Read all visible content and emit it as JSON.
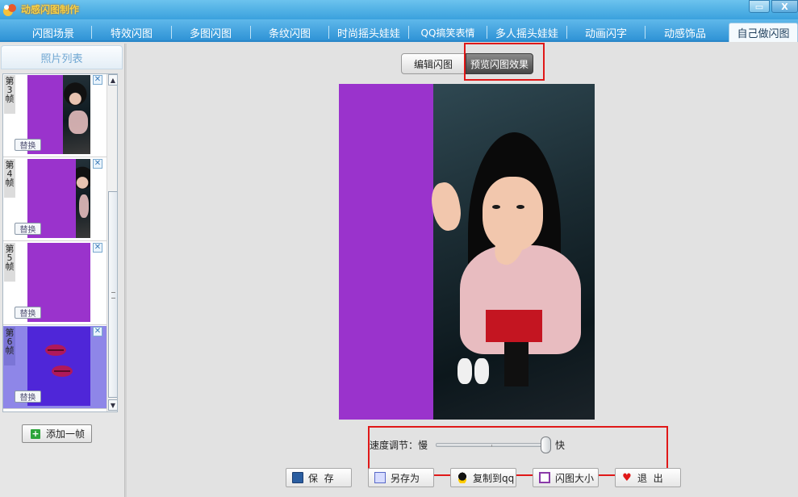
{
  "titlebar": {
    "title": "动感闪图制作",
    "max_glyph": "▭",
    "close_glyph": "X"
  },
  "tabs": [
    {
      "label": "闪图场景"
    },
    {
      "label": "特效闪图"
    },
    {
      "label": "多图闪图"
    },
    {
      "label": "条纹闪图"
    },
    {
      "label": "时尚摇头娃娃"
    },
    {
      "label": "QQ搞笑表情"
    },
    {
      "label": "多人摇头娃娃"
    },
    {
      "label": "动画闪字"
    },
    {
      "label": "动感饰品"
    },
    {
      "label": "自己做闪图",
      "active": true
    }
  ],
  "left_panel": {
    "header": "照片列表",
    "frames": [
      {
        "label_top": "第",
        "label_num": "3",
        "label_bottom": "帧",
        "replace": "替换",
        "delete": "✕"
      },
      {
        "label_top": "第",
        "label_num": "4",
        "label_bottom": "帧",
        "replace": "替换",
        "delete": "✕"
      },
      {
        "label_top": "第",
        "label_num": "5",
        "label_bottom": "帧",
        "replace": "替换",
        "delete": "✕"
      },
      {
        "label_top": "第",
        "label_num": "6",
        "label_bottom": "帧",
        "replace": "替换",
        "delete": "✕",
        "selected": true
      }
    ],
    "scroll_up": "▲",
    "scroll_down": "▼",
    "add_frame": "添加一帧",
    "add_glyph": "+"
  },
  "modes": {
    "edit": "编辑闪图",
    "preview": "预览闪图效果"
  },
  "speed": {
    "label": "速度调节：慢",
    "fast": "快",
    "value": 0.93
  },
  "buttons": {
    "save": "保  存",
    "save_as": "另存为",
    "copy_qq": "复制到qq",
    "size": "闪图大小",
    "exit": "退  出",
    "exit_glyph": "♥"
  },
  "colors": {
    "titlebar": "#3aa1dd",
    "frame_purple": "#9a33cc",
    "highlight_red": "#e01818",
    "selected_frame": "#8e86e8"
  }
}
